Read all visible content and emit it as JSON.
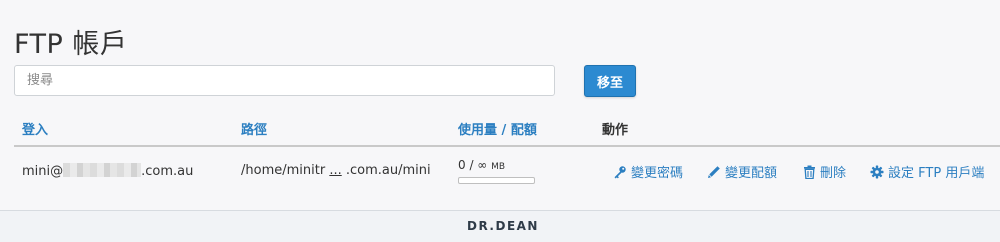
{
  "page": {
    "title": "FTP 帳戶"
  },
  "search": {
    "placeholder": "搜尋",
    "go_label": "移至"
  },
  "table": {
    "headers": {
      "login": "登入",
      "path": "路徑",
      "usage": "使用量",
      "quota": "配額",
      "actions": "動作"
    },
    "rows": [
      {
        "login_prefix": "mini@",
        "login_suffix": ".com.au",
        "path_prefix": "/home/minitr",
        "path_ellipsis": "...",
        "path_suffix": ".com.au/mini",
        "usage": "0 / ∞",
        "usage_unit": "MB",
        "usage_fraction": 0,
        "actions": {
          "change_password": "變更密碼",
          "change_quota": "變更配額",
          "delete": "刪除",
          "configure_prefix": "設定",
          "configure_ftp": "FTP",
          "configure_suffix": "用戶端"
        }
      }
    ]
  },
  "footer": {
    "brand": "DR.DEAN"
  },
  "colors": {
    "accent": "#2c8ad1",
    "link": "#2c7fc1"
  }
}
